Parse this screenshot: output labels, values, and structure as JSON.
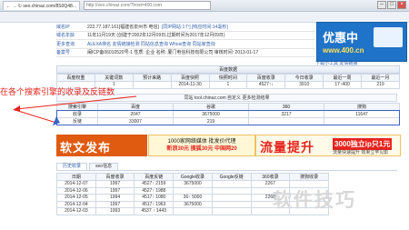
{
  "browser": {
    "tab_title": "← → ↻ seo.chinaz.com/8S0Q48...",
    "tab2_title": "×",
    "address": "http://seo.chinaz.com/?host=400.com",
    "min": "–",
    "max": "□",
    "close": "×"
  },
  "site_info": [
    {
      "label": "域名IP",
      "value": "222.77.187.161[福建省泉州市 电信]",
      "link": "[同IP网站:1个] [响应时间:14毫秒]"
    },
    {
      "label": "域名年龄",
      "value": "11年11月19天 (创建于2002年12月09日,过期时间为2017年12月09日)",
      "link": ""
    },
    {
      "label": "更多查询",
      "value": "ALEXA排名   友情链接检测   同站信息查询   Whois查询   同站家查询",
      "link": ""
    },
    {
      "label": "备案号",
      "value": "闽ICP备06010520号-1  性质: 企业  名称: 厦门电信科技有限公司  审核时间: 2013-01-17",
      "link": ""
    }
  ],
  "ad_top": {
    "brand": "优惠中",
    "url": "www.400.cn",
    "footer": "下载小工具   友情链接"
  },
  "index_section": {
    "title": "百度数据",
    "headers": [
      "百度权重",
      "关键词数",
      "预计来路",
      "百度快照",
      "快照时间",
      "百度收录",
      "今日收录",
      "最近一周",
      "最近一月"
    ],
    "values": [
      "",
      "1",
      "",
      "2014-11-30",
      "1",
      "4527↑↓",
      "3910",
      "17↑400",
      "219"
    ]
  },
  "seo_link_bar": "同站 tool.chinaz.com 自定义 更多检测结果",
  "annotation": "在各个搜索引擎的收录及反链数",
  "engines": {
    "headers": [
      "搜索引擎",
      "百度",
      "谷歌",
      "360",
      "搜狗"
    ],
    "rows": [
      {
        "label": "收录",
        "values": [
          "2047",
          "3675000",
          "3217",
          "11647"
        ]
      },
      {
        "label": "反链",
        "values": [
          "33007",
          "219",
          "",
          ""
        ]
      }
    ]
  },
  "banners": {
    "left": "软文发布",
    "mid_line1": "1000家网络媒体  批发价代理",
    "mid_line2": "新浪30元 搜狐30元 中国网20",
    "right": "流量提升",
    "right_sub": "3000独立ip只1元",
    "right_sub2": "流量快速提升  效果立竿见影"
  },
  "history": {
    "tabs": [
      "历史收录",
      "seo信息"
    ],
    "headers": [
      "日期",
      "百度收录",
      "百度反链",
      "Google收录",
      "Google反链",
      "360收录",
      "搜狗收录"
    ],
    "rows": [
      [
        "2014-12-07",
        "1997",
        "4527↑ 2159",
        "3675000",
        "",
        "2267",
        ""
      ],
      [
        "2014-12-06",
        "1997",
        "4527↑ 1988",
        "",
        "",
        "",
        ""
      ],
      [
        "2014-12-05",
        "1994",
        "4517↑ 1080",
        "36↑ 5000",
        "",
        "2268",
        ""
      ],
      [
        "2014-12-04",
        "1997",
        "4517↑ 1963",
        "3675000",
        "",
        "",
        ""
      ],
      [
        "2014-12-03",
        "1993",
        "4537 ↑ 1443",
        "",
        "",
        "",
        ""
      ]
    ]
  },
  "watermark": "软件技巧",
  "colors": {
    "annotation": "#e8231d",
    "highlight": "#3b62c7",
    "link": "#2d5ca8",
    "accent": "#d7601a"
  }
}
